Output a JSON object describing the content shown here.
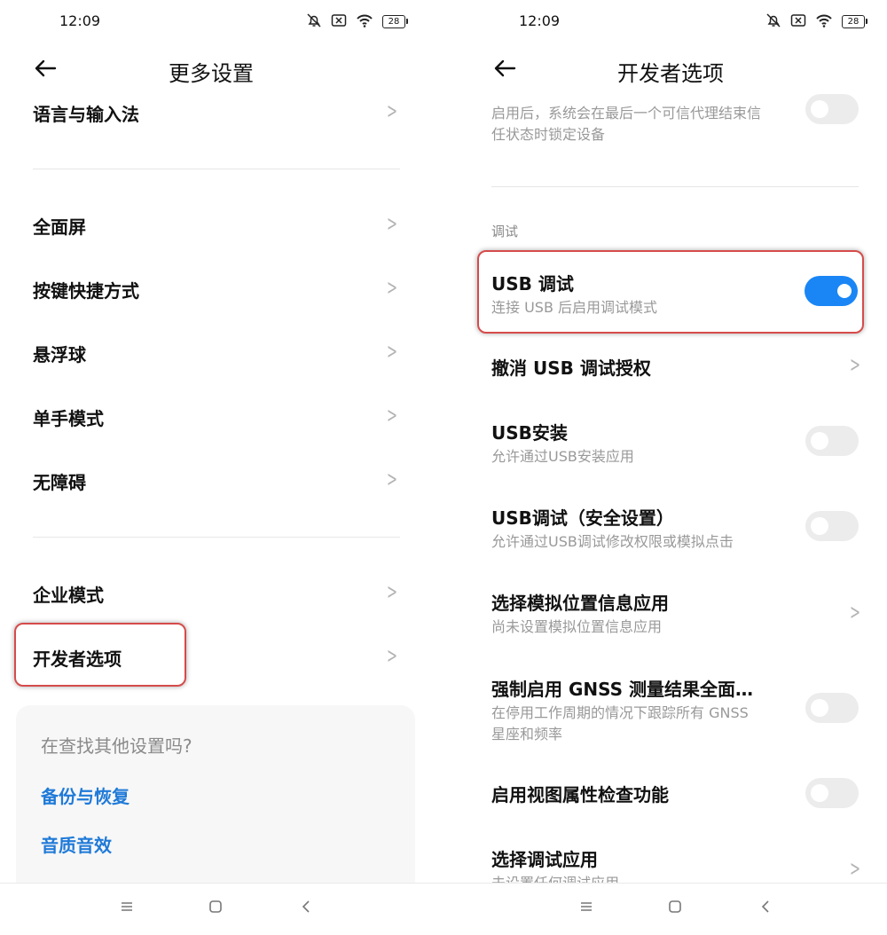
{
  "left": {
    "status": {
      "time": "12:09",
      "battery": "28",
      "icons": [
        "mute-bell-icon",
        "no-sim-icon",
        "wifi-icon",
        "battery-icon"
      ]
    },
    "title": "更多设置",
    "items": [
      {
        "label": "语言与输入法"
      },
      {
        "label": "全面屏"
      },
      {
        "label": "按键快捷方式"
      },
      {
        "label": "悬浮球"
      },
      {
        "label": "单手模式"
      },
      {
        "label": "无障碍"
      },
      {
        "label": "企业模式"
      },
      {
        "label": "开发者选项",
        "highlighted": true
      }
    ],
    "suggest": {
      "title": "在查找其他设置吗?",
      "links": [
        "备份与恢复",
        "音质音效"
      ]
    }
  },
  "right": {
    "status": {
      "time": "12:09",
      "battery": "28"
    },
    "title": "开发者选项",
    "top_desc": "启用后，系统会在最后一个可信代理结束信任状态时锁定设备",
    "top_desc_line1": "启用后，系统会在最后一个可信代理结束信",
    "top_desc_line2": "任状态时锁定设备",
    "section": "调试",
    "items": [
      {
        "title": "USB 调试",
        "sub": "连接 USB 后启用调试模式",
        "control": "toggle",
        "on": true,
        "highlighted": true
      },
      {
        "title": "撤消 USB 调试授权",
        "control": "chevron"
      },
      {
        "title": "USB安装",
        "sub": "允许通过USB安装应用",
        "control": "toggle",
        "on": false
      },
      {
        "title": "USB调试（安全设置）",
        "sub": "允许通过USB调试修改权限或模拟点击",
        "control": "toggle",
        "on": false
      },
      {
        "title": "选择模拟位置信息应用",
        "sub": "尚未设置模拟位置信息应用",
        "control": "chevron"
      },
      {
        "title": "强制启用 GNSS 测量结果全面…",
        "sub_line1": "在停用工作周期的情况下跟踪所有 GNSS",
        "sub_line2": "星座和频率",
        "control": "toggle",
        "on": false
      },
      {
        "title": "启用视图属性检查功能",
        "control": "toggle",
        "on": false
      },
      {
        "title": "选择调试应用",
        "sub": "未设置任何调试应用",
        "control": "chevron"
      }
    ]
  },
  "navbar": {
    "icons": [
      "menu-icon",
      "home-icon",
      "back-icon"
    ]
  },
  "colors": {
    "accent": "#1a86f5",
    "link": "#1f7ad8",
    "highlight_border": "#d64b4b"
  }
}
